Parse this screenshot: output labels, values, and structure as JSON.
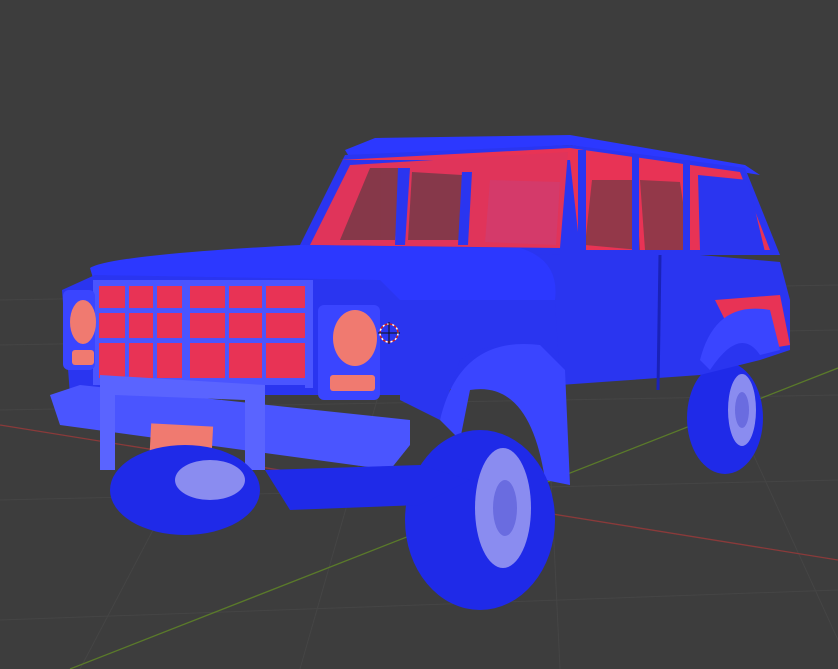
{
  "viewport": {
    "background": "#3d3d3d",
    "grid_color": "#454545",
    "x_axis_color": "#8a3a3a",
    "y_axis_color": "#5a7a2a"
  },
  "model": {
    "name": "truck-model",
    "body_color": "#2a35f0",
    "body_light_color": "#4a55ff",
    "body_dark_color": "#1a22b8",
    "interior_color": "#e83355",
    "glass_color": "#d43a6a",
    "light_color": "#f07a70",
    "rim_color": "#8a8cf0"
  },
  "cursor_3d": {
    "icon": "3d-cursor-icon"
  }
}
